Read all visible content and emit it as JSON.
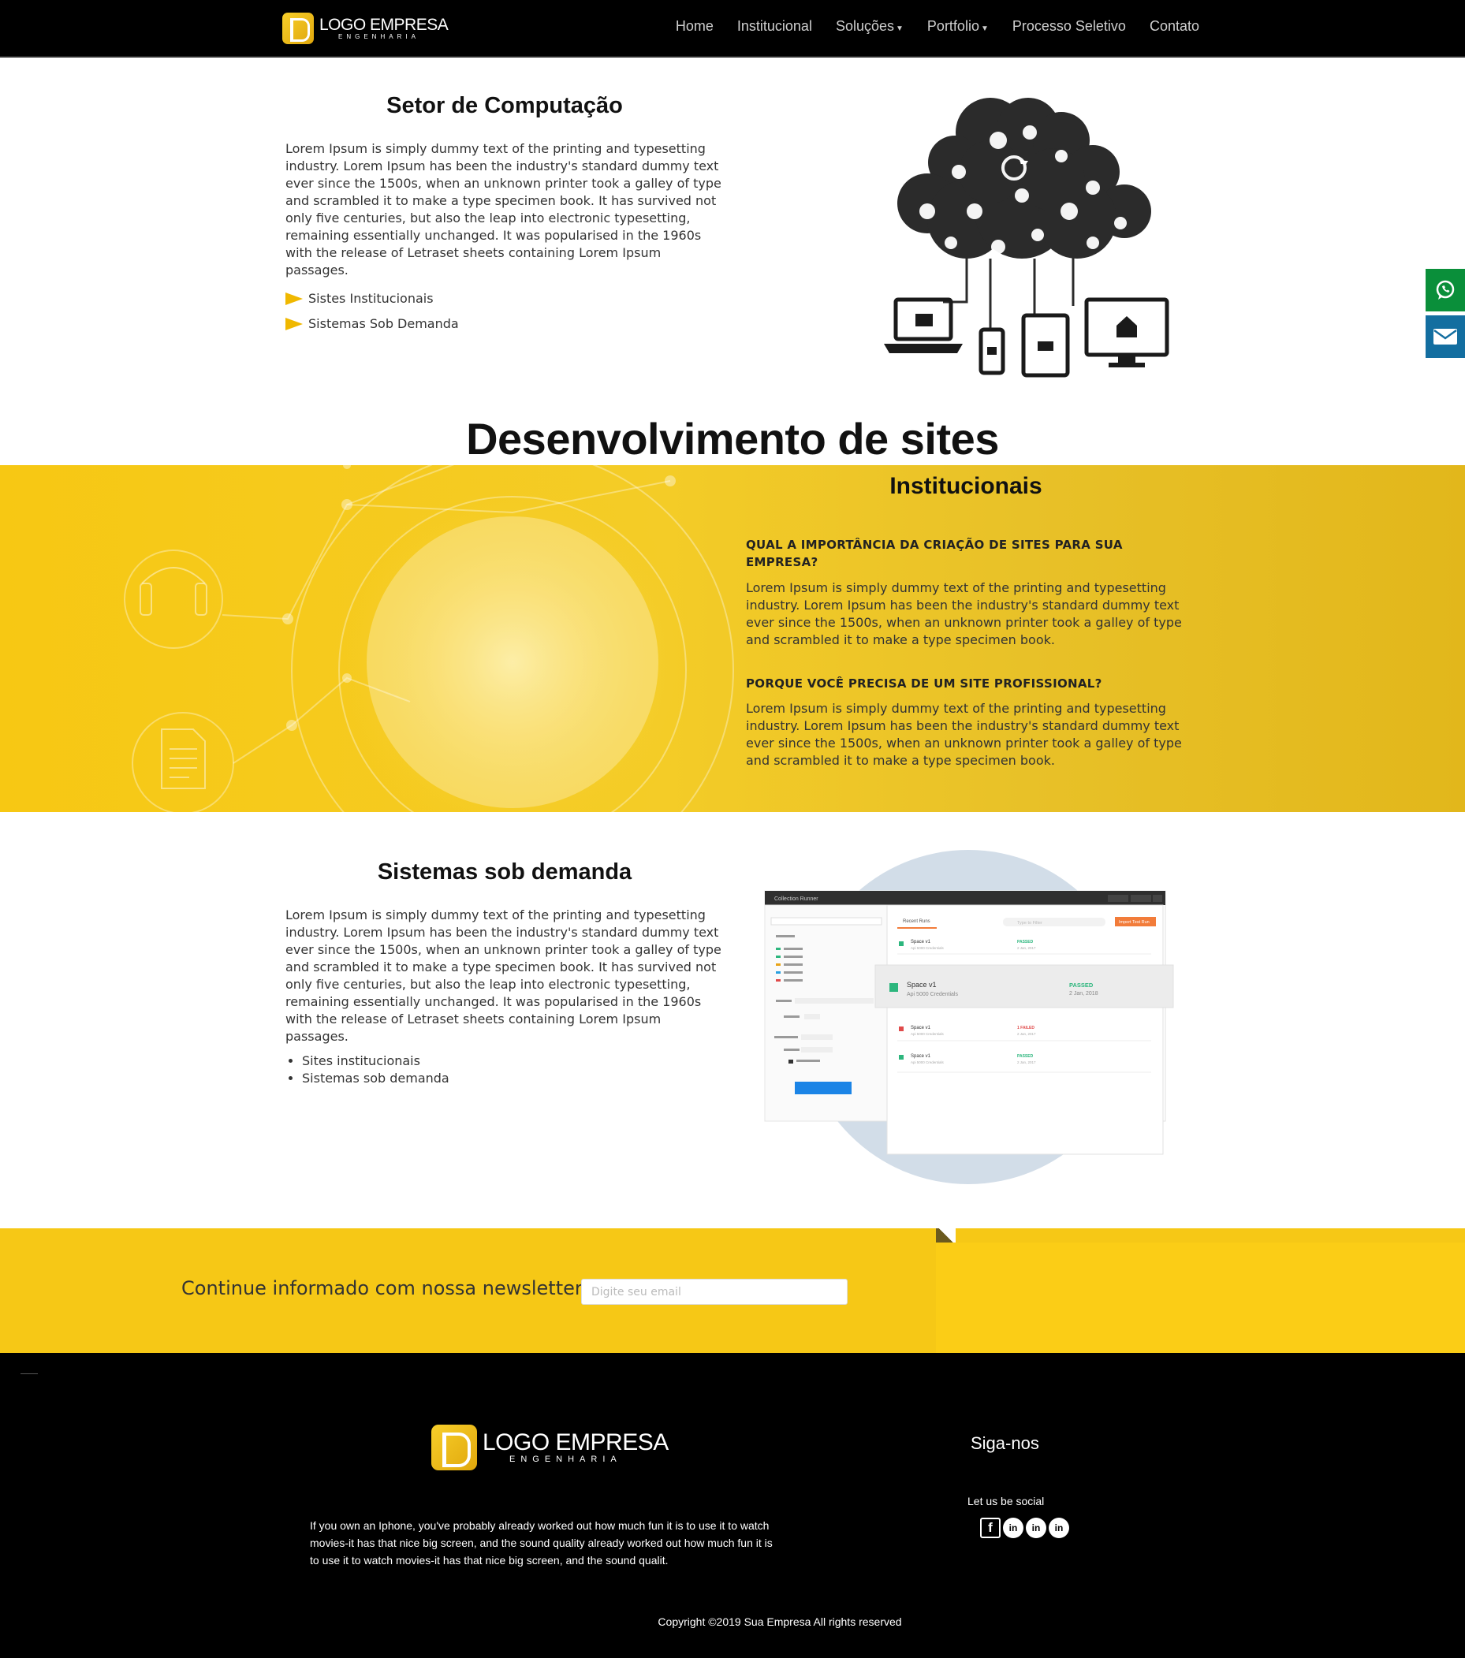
{
  "header": {
    "logo_title": "LOGO EMPRESA",
    "logo_subtitle": "ENGENHARIA",
    "nav": {
      "home": "Home",
      "institucional": "Institucional",
      "solucoes": "Soluções",
      "portfolio": "Portfolio",
      "processo": "Processo Seletivo",
      "contato": "Contato"
    }
  },
  "side_buttons": {
    "whatsapp_icon": "whatsapp-icon",
    "mail_icon": "envelope-icon",
    "whatsapp_color": "#0a8f3a",
    "mail_color": "#136ea0"
  },
  "computacao": {
    "title": "Setor de Computação",
    "text": "Lorem Ipsum is simply dummy text of the printing and typesetting industry. Lorem Ipsum has been the industry's standard dummy text ever since the 1500s, when an unknown printer took a galley of type and scrambled it to make a type specimen book. It has survived not only five centuries, but also the leap into electronic typesetting, remaining essentially unchanged. It was popularised in the 1960s with the release of Letraset sheets containing Lorem Ipsum passages.",
    "items": [
      "Sistes Institucionais",
      "Sistemas Sob Demanda"
    ]
  },
  "desenvolvimento": {
    "title": "Desenvolvimento de sites",
    "subtitle": "Institucionais",
    "q1": "QUAL A IMPORTÂNCIA DA CRIAÇÃO DE SITES PARA SUA EMPRESA?",
    "a1": "Lorem Ipsum is simply dummy text of the printing and typesetting industry. Lorem Ipsum has been the industry's standard dummy text ever since the 1500s, when an unknown printer took a galley of type and scrambled it to make a type specimen book.",
    "q2": "PORQUE VOCÊ PRECISA DE UM SITE PROFISSIONAL?",
    "a2": "Lorem Ipsum is simply dummy text of the printing and typesetting industry. Lorem Ipsum has been the industry's standard dummy text ever since the 1500s, when an unknown printer took a galley of type and scrambled it to make a type specimen book."
  },
  "sistemas": {
    "title": "Sistemas sob demanda",
    "text": "Lorem Ipsum is simply dummy text of the printing and typesetting industry. Lorem Ipsum has been the industry's standard dummy text ever since the 1500s, when an unknown printer took a galley of type and scrambled it to make a type specimen book. It has survived not only five centuries, but also the leap into electronic typesetting, remaining essentially unchanged. It was popularised in the 1960s with the release of Letraset sheets containing Lorem Ipsum passages.",
    "items": [
      "Sites institucionais",
      "Sistemas sob demanda"
    ],
    "mockup": {
      "window_title": "Collection Runner",
      "tab": "Recent Runs",
      "filter_placeholder": "Type to Filter",
      "import_button": "Import Test Run",
      "featured": {
        "name": "Space v1",
        "sub": "Api 5000 Credentials",
        "status": "PASSED",
        "date": "2 Jan, 2018"
      },
      "rows": [
        {
          "name": "Space v1",
          "sub": "Api 5000 Credentials",
          "status": "PASSED",
          "date": "2 Jan, 2017"
        },
        {
          "name": "Space v1",
          "sub": "Api 5000 Credentials",
          "status": "1 FAILED",
          "date": "2 Jan, 2017"
        },
        {
          "name": "Space v1",
          "sub": "Api 5000 Credentials",
          "status": "PASSED",
          "date": "2 Jan, 2017"
        }
      ]
    }
  },
  "newsletter": {
    "label": "Continue informado com nossa newsletter",
    "placeholder": "Digite seu email"
  },
  "footer": {
    "logo_title": "LOGO EMPRESA",
    "logo_subtitle": "ENGENHARIA",
    "text": "If you own an Iphone, you've probably already worked out how much fun it is to use it to watch movies-it has that nice big screen, and the sound quality already worked out how much fun it is to use it to watch movies-it has that nice big screen, and the sound qualit.",
    "follow_title": "Siga-nos",
    "social_label": "Let us be social",
    "social": {
      "facebook": "f",
      "linkedin": "in"
    },
    "copyright": "Copyright ©2019 Sua Empresa All rights reserved"
  },
  "colors": {
    "brand_yellow": "#f6c816",
    "nav_bg": "#000000",
    "accent_arrow": "#f0b800"
  }
}
